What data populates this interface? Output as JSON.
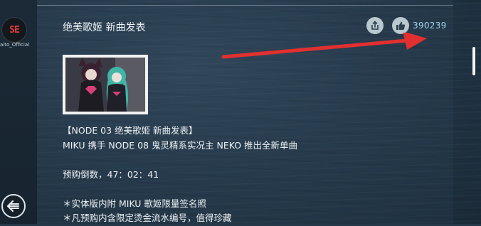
{
  "author": {
    "logo_text": "SE",
    "name": "aito_Official"
  },
  "post": {
    "title": "绝美歌姬 新曲发表",
    "like_count": "390239",
    "body_lines": [
      "【NODE 03 绝美歌姬 新曲发表】",
      "MIKU 携手 NODE 08 鬼灵精系实况主 NEKO 推出全新单曲",
      "",
      "预购倒数，47：02：41",
      "",
      "＊实体版内附 MIKU 歌姬限量签名照",
      "＊凡预购内含限定烫金流水编号，值得珍藏"
    ]
  },
  "icons": {
    "share": "share-icon",
    "like": "thumbs-up-icon",
    "back": "back-icon",
    "annotation": "red-arrow-annotation"
  },
  "colors": {
    "accent_count": "#9fd2ea",
    "annotation_arrow": "#e23030",
    "logo_red": "#e23c3c"
  }
}
